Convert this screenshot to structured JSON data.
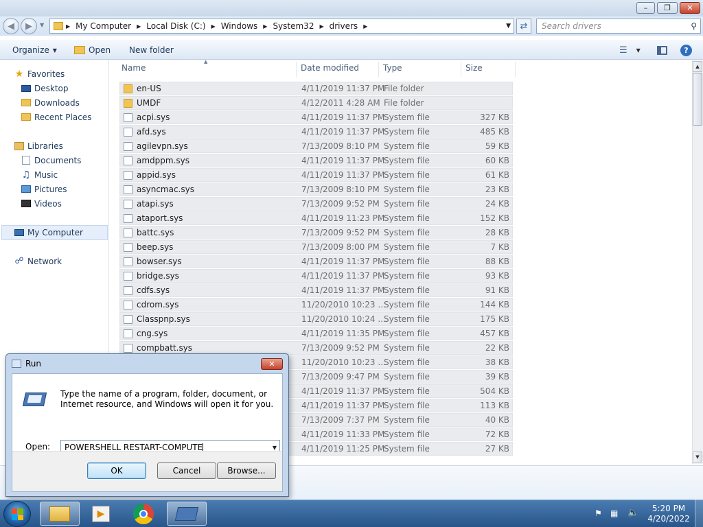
{
  "window": {
    "minimize_glyph": "–",
    "maximize_glyph": "❐",
    "close_glyph": "✕"
  },
  "address": {
    "crumbs": [
      "My Computer",
      "Local Disk (C:)",
      "Windows",
      "System32",
      "drivers"
    ],
    "search_placeholder": "Search drivers"
  },
  "toolbar": {
    "organize": "Organize",
    "open": "Open",
    "new_folder": "New folder"
  },
  "nav": {
    "favorites": "Favorites",
    "desktop": "Desktop",
    "downloads": "Downloads",
    "recent_places": "Recent Places",
    "libraries": "Libraries",
    "documents": "Documents",
    "music": "Music",
    "pictures": "Pictures",
    "videos": "Videos",
    "my_computer": "My Computer",
    "network": "Network"
  },
  "columns": {
    "name": "Name",
    "date_modified": "Date modified",
    "type": "Type",
    "size": "Size"
  },
  "files": [
    {
      "name": "en-US",
      "date": "4/11/2019 11:37 PM",
      "type": "File folder",
      "size": "",
      "kind": "folder"
    },
    {
      "name": "UMDF",
      "date": "4/12/2011 4:28 AM",
      "type": "File folder",
      "size": "",
      "kind": "folder"
    },
    {
      "name": "acpi.sys",
      "date": "4/11/2019 11:37 PM",
      "type": "System file",
      "size": "327 KB",
      "kind": "file"
    },
    {
      "name": "afd.sys",
      "date": "4/11/2019 11:37 PM",
      "type": "System file",
      "size": "485 KB",
      "kind": "file"
    },
    {
      "name": "agilevpn.sys",
      "date": "7/13/2009 8:10 PM",
      "type": "System file",
      "size": "59 KB",
      "kind": "file"
    },
    {
      "name": "amdppm.sys",
      "date": "4/11/2019 11:37 PM",
      "type": "System file",
      "size": "60 KB",
      "kind": "file"
    },
    {
      "name": "appid.sys",
      "date": "4/11/2019 11:37 PM",
      "type": "System file",
      "size": "61 KB",
      "kind": "file"
    },
    {
      "name": "asyncmac.sys",
      "date": "7/13/2009 8:10 PM",
      "type": "System file",
      "size": "23 KB",
      "kind": "file"
    },
    {
      "name": "atapi.sys",
      "date": "7/13/2009 9:52 PM",
      "type": "System file",
      "size": "24 KB",
      "kind": "file"
    },
    {
      "name": "ataport.sys",
      "date": "4/11/2019 11:23 PM",
      "type": "System file",
      "size": "152 KB",
      "kind": "file"
    },
    {
      "name": "battc.sys",
      "date": "7/13/2009 9:52 PM",
      "type": "System file",
      "size": "28 KB",
      "kind": "file"
    },
    {
      "name": "beep.sys",
      "date": "7/13/2009 8:00 PM",
      "type": "System file",
      "size": "7 KB",
      "kind": "file"
    },
    {
      "name": "bowser.sys",
      "date": "4/11/2019 11:37 PM",
      "type": "System file",
      "size": "88 KB",
      "kind": "file"
    },
    {
      "name": "bridge.sys",
      "date": "4/11/2019 11:37 PM",
      "type": "System file",
      "size": "93 KB",
      "kind": "file"
    },
    {
      "name": "cdfs.sys",
      "date": "4/11/2019 11:37 PM",
      "type": "System file",
      "size": "91 KB",
      "kind": "file"
    },
    {
      "name": "cdrom.sys",
      "date": "11/20/2010 10:23 ...",
      "type": "System file",
      "size": "144 KB",
      "kind": "file"
    },
    {
      "name": "Classpnp.sys",
      "date": "11/20/2010 10:24 ...",
      "type": "System file",
      "size": "175 KB",
      "kind": "file"
    },
    {
      "name": "cng.sys",
      "date": "4/11/2019 11:35 PM",
      "type": "System file",
      "size": "457 KB",
      "kind": "file"
    },
    {
      "name": "compbatt.sys",
      "date": "7/13/2009 9:52 PM",
      "type": "System file",
      "size": "22 KB",
      "kind": "file"
    },
    {
      "name": "",
      "date": "11/20/2010 10:23 ...",
      "type": "System file",
      "size": "38 KB",
      "kind": "file"
    },
    {
      "name": "",
      "date": "7/13/2009 9:47 PM",
      "type": "System file",
      "size": "39 KB",
      "kind": "file"
    },
    {
      "name": "",
      "date": "4/11/2019 11:37 PM",
      "type": "System file",
      "size": "504 KB",
      "kind": "file"
    },
    {
      "name": "",
      "date": "4/11/2019 11:37 PM",
      "type": "System file",
      "size": "113 KB",
      "kind": "file"
    },
    {
      "name": "",
      "date": "7/13/2009 7:37 PM",
      "type": "System file",
      "size": "40 KB",
      "kind": "file"
    },
    {
      "name": "",
      "date": "4/11/2019 11:33 PM",
      "type": "System file",
      "size": "72 KB",
      "kind": "file"
    },
    {
      "name": "",
      "date": "4/11/2019 11:25 PM",
      "type": "System file",
      "size": "27 KB",
      "kind": "file"
    }
  ],
  "run_dialog": {
    "title": "Run",
    "description": "Type the name of a program, folder, document, or Internet resource, and Windows will open it for you.",
    "open_label": "Open:",
    "command": "POWERSHELL RESTART-COMPUTE",
    "ok": "OK",
    "cancel": "Cancel",
    "browse": "Browse..."
  },
  "clock": {
    "time": "5:20 PM",
    "date": "4/20/2022"
  }
}
